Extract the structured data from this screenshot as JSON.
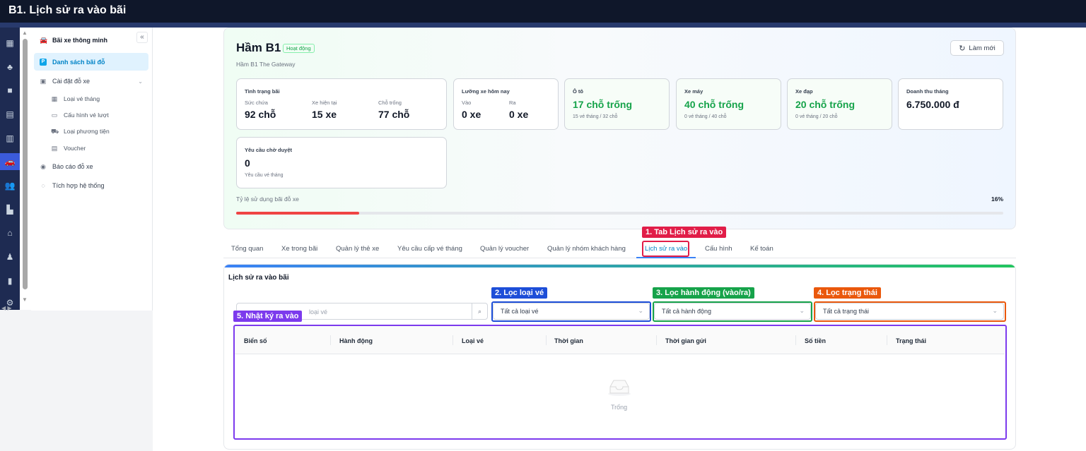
{
  "window_title": "B1. Lịch sử ra vào bãi",
  "rail_icons": [
    "building-icon",
    "tree-icon",
    "chat-icon",
    "calculator-icon",
    "briefcase-icon",
    "car-icon",
    "users-icon",
    "office-icon",
    "store-icon",
    "person-icon",
    "chart-icon",
    "settings-icon"
  ],
  "sidebar": {
    "collapse_label": "«",
    "items": [
      {
        "label": "Bãi xe thông minh",
        "icon": "car-icon"
      },
      {
        "label": "Danh sách bãi đỗ",
        "icon": "parking-icon"
      },
      {
        "label": "Cài đặt đỗ xe",
        "icon": "parking-settings-icon"
      },
      {
        "label": "Loại vé tháng",
        "icon": "ticket-icon"
      },
      {
        "label": "Cấu hình vé lượt",
        "icon": "card-icon"
      },
      {
        "label": "Loại phương tiện",
        "icon": "vehicle-icon"
      },
      {
        "label": "Voucher",
        "icon": "voucher-icon"
      },
      {
        "label": "Báo cáo đỗ xe",
        "icon": "report-icon"
      },
      {
        "label": "Tích hợp hệ thống",
        "icon": "integration-icon"
      }
    ]
  },
  "header": {
    "title": "Hầm B1",
    "badge": "Hoạt động",
    "subtitle": "Hầm B1 The Gateway",
    "refresh_label": "Làm mới"
  },
  "stats": {
    "status": {
      "title": "Tình trạng bãi",
      "capacity_label": "Sức chứa",
      "capacity_value": "92 chỗ",
      "current_label": "Xe hiện tại",
      "current_value": "15 xe",
      "free_label": "Chỗ trống",
      "free_value": "77 chỗ"
    },
    "traffic": {
      "title": "Lưỡng xe hôm nay",
      "in_label": "Vào",
      "in_value": "0 xe",
      "out_label": "Ra",
      "out_value": "0 xe"
    },
    "car": {
      "title": "Ô tô",
      "value": "17 chỗ trống",
      "note": "15 vé tháng / 32 chỗ"
    },
    "moto": {
      "title": "Xe máy",
      "value": "40 chỗ trống",
      "note": "0 vé tháng / 40 chỗ"
    },
    "bike": {
      "title": "Xe đạp",
      "value": "20 chỗ trống",
      "note": "0 vé tháng / 20 chỗ"
    },
    "revenue": {
      "title": "Doanh thu tháng",
      "value": "6.750.000 đ"
    },
    "pending": {
      "title": "Yêu cầu chờ duyệt",
      "value": "0",
      "note": "Yêu cầu vé tháng"
    }
  },
  "usage": {
    "label": "Tỷ lệ sử dụng bãi đỗ xe",
    "percent_text": "16%",
    "fraction": 0.16
  },
  "tabs": [
    "Tổng quan",
    "Xe trong bãi",
    "Quản lý thẻ xe",
    "Yêu cầu cấp vé tháng",
    "Quản lý voucher",
    "Quản lý nhóm khách hàng",
    "Lịch sử ra vào",
    "Cấu hình",
    "Kế toán"
  ],
  "active_tab": "Lịch sử ra vào",
  "panel": {
    "title": "Lịch sử ra vào bãi",
    "search_placeholder": "loại vé",
    "filter_ticket": "Tất cả loại vé",
    "filter_action": "Tất cả hành động",
    "filter_status": "Tất cả trạng thái",
    "columns": [
      "Biển số",
      "Hành động",
      "Loại vé",
      "Thời gian",
      "Thời gian gửi",
      "Số tiền",
      "Trạng thái"
    ],
    "empty_text": "Trống"
  },
  "annotations": {
    "a1": "1. Tab Lịch sử ra vào",
    "a2": "2. Lọc loại vé",
    "a3": "3. Lọc hành động (vào/ra)",
    "a4": "4. Lọc trạng thái",
    "a5": "5. Nhật ký ra vào"
  },
  "colors": {
    "a1": "#e11d48",
    "a2": "#1d4ed8",
    "a3": "#16a34a",
    "a4": "#ea580c",
    "a5": "#7c3aed",
    "accent": "#0284c7",
    "success": "#16a34a"
  }
}
